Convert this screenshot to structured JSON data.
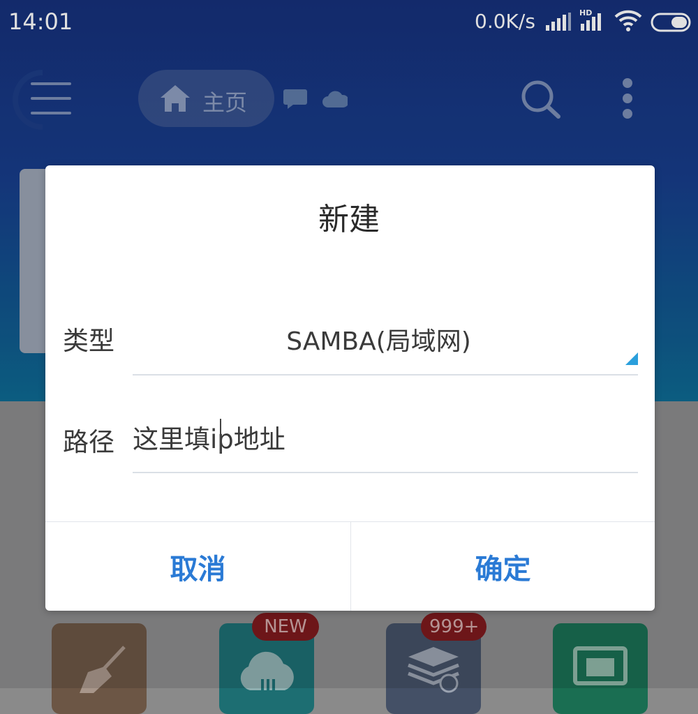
{
  "status_bar": {
    "time": "14:01",
    "net_speed": "0.0K/s",
    "hd_label": "HD"
  },
  "toolbar": {
    "home_label": "主页"
  },
  "tiles": {
    "badge_new": "NEW",
    "badge_count": "999+"
  },
  "dialog": {
    "title": "新建",
    "type_label": "类型",
    "type_value": "SAMBA(局域网)",
    "path_label": "路径",
    "path_value": "这里填ip地址",
    "cancel_label": "取消",
    "confirm_label": "确定"
  },
  "colors": {
    "accent": "#2a7ad5",
    "dropdown_arrow": "#2a9fdc",
    "header_blue": "#173d8a"
  },
  "icons": [
    "menu-icon",
    "home-icon",
    "chat-icon",
    "cloud-icon",
    "search-icon",
    "more-icon",
    "signal-icon",
    "wifi-icon",
    "battery-icon",
    "broom-icon",
    "upload-cloud-icon",
    "stack-icon",
    "cast-icon"
  ]
}
